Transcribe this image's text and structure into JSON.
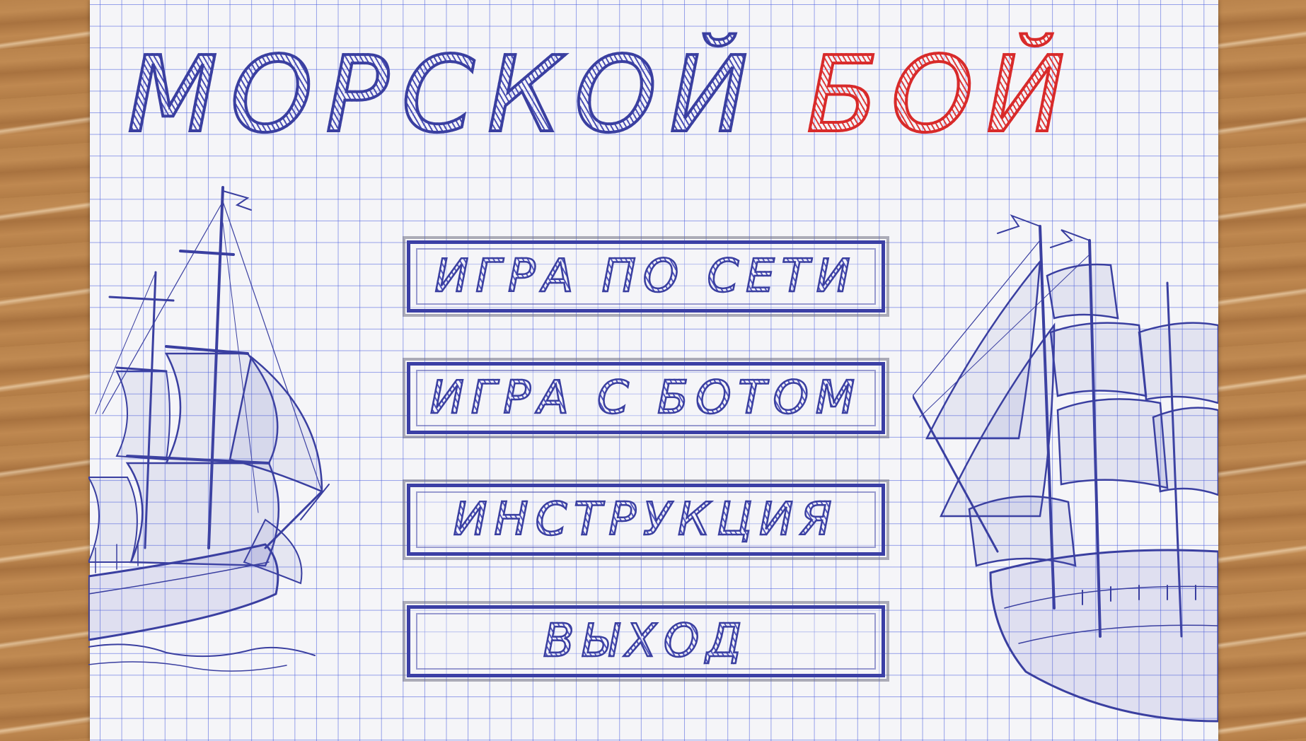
{
  "title": {
    "word1": "МОРСКОЙ",
    "word2": "БОЙ"
  },
  "menu": {
    "items": [
      {
        "label": "ИГРА ПО СЕТИ"
      },
      {
        "label": "ИГРА С БОТОМ"
      },
      {
        "label": "ИНСТРУКЦИЯ"
      },
      {
        "label": "ВЫХОД"
      }
    ]
  },
  "colors": {
    "ink_blue": "#3a3fa0",
    "ink_red": "#d82a2a",
    "paper": "#f5f5f8",
    "grid": "#465adc",
    "wood": "#b9834c"
  },
  "decorations": {
    "left_ship": "sailing-ship-sketch",
    "right_ship": "sailing-ship-sketch"
  }
}
